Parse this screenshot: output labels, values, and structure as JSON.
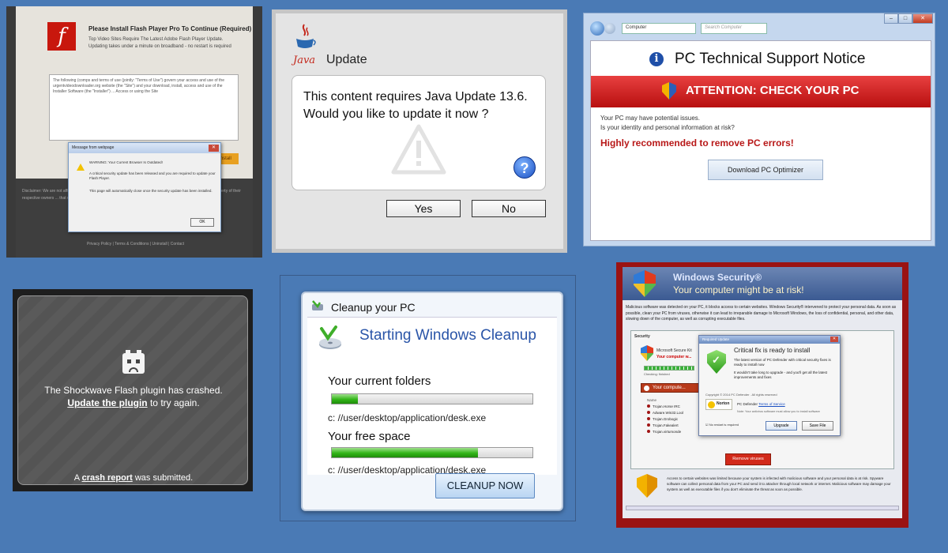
{
  "flash_panel": {
    "title": "Please Install Flash Player Pro To Continue (Required)",
    "subtitle_1": "Top Video Sites Require The Latest Adobe Flash Player Update.",
    "subtitle_2": "Updating takes under a minute on broadband - no restart is required",
    "terms": "The following (comps and terms of use (jointly: \"Terms of Use\") govern your access and use of the urgentvideodownloader.org website (the \"Site\") and your download, install, access and use of the Installer Software (the \"Installer\") ... Access or using the Site",
    "install_label": "Install",
    "footer_text": "Disclaimer: We are not affiliated with the software or its creators ... advertisement or software ... retailers) are property of their respective owners ... that will update the above ...",
    "footer_links": "Privacy Policy  |  Terms & Conditions  |  Uninstall  |  Contact",
    "dialog": {
      "title": "Message from webpage",
      "warning": "WARNING: Your Current Browser Is Outdated!",
      "body": "A critical security update has been released and you are required to update your Flash Player.",
      "note": "This page will automatically close once the security update has been installed.",
      "ok": "OK"
    }
  },
  "java_panel": {
    "logo_text": "Java",
    "title": "Update",
    "message_line1": "This content requires Java Update 13.6.",
    "message_line2": "Would you like to update it now ?",
    "help": "?",
    "yes": "Yes",
    "no": "No"
  },
  "pc_support_panel": {
    "address": "Computer",
    "search_placeholder": "Search Computer",
    "title": "PC Technical Support Notice",
    "attention": "ATTENTION: CHECK YOUR PC",
    "line1": "Your PC may have potential issues.",
    "line2": "Is your identity and personal information at risk?",
    "warning": "Highly recommended to remove PC errors!",
    "button": "Download PC Optimizer"
  },
  "shockwave_panel": {
    "line1": "The Shockwave Flash plugin has crashed.",
    "update_link": "Update the plugin",
    "line2_suffix": " to try again.",
    "report_prefix": "A ",
    "report_link": "crash report",
    "report_suffix": " was submitted."
  },
  "cleanup_panel": {
    "header": "Cleanup your PC",
    "title": "Starting Windows Cleanup",
    "folders_label": "Your current folders",
    "folders_progress": 0.13,
    "folders_path": "c: //user/desktop/application/desk.exe",
    "space_label": "Your free space",
    "space_progress": 0.73,
    "space_path": "c: //user/desktop/application/desk.exe",
    "button": "CLEANUP NOW"
  },
  "windows_security_panel": {
    "title": "Windows Security®",
    "subtitle": "Your computer might be at risk!",
    "intro": "Malicious software was detected on your PC, it blocks access to certain websites. Windows Security® intervened to protect your personal data. As soon as possible, clean your PC from viruses, otherwise it can lead to irreparable damage to Microsoft Windows, the loss of confidential, personal, and other data, slowing down of the computer, as well as corrupting executable files.",
    "security_tab": "Security",
    "kit_label": "Microsoft Secure Kit",
    "risk_label": "Your computer w...",
    "checking": "Checking: finished",
    "red_row": "Your compute...",
    "threats_header": "Name",
    "threats": [
      "Trojan.Horse IRC",
      "Adware.Win32.Lool",
      "Trojan.Grobogic",
      "Trojan.Fakealert",
      "Trojan.virtumonde"
    ],
    "remove_button": "Remove viruses",
    "popup": {
      "title": "Required Update",
      "heading": "Critical fix is ready to install",
      "p1": "The latest version of PC Defender with critical security fixes is ready to install now",
      "p2": "It wouldn't take long to upgrade - and you'll get all the latest improvements and fixes",
      "copyright": "Copyright © 2014 PC Defender . All rights reserved",
      "norton": "Norton",
      "product": "PC Defender",
      "terms": "Terms of Service",
      "note": "Note: Your antivirus software must allow you to install software",
      "restart": "No restart is required",
      "upgrade": "Upgrade",
      "save": "Save File"
    },
    "bottom_text": "Access to certain websites was limited because your system is infected with malicious software and your personal data is at risk. Spyware software can collect personal data from your PC and send it to attacker through local network or internet. Malicious software may damage your system as well as executable files if you don't eliminate the threat as soon as possible."
  }
}
